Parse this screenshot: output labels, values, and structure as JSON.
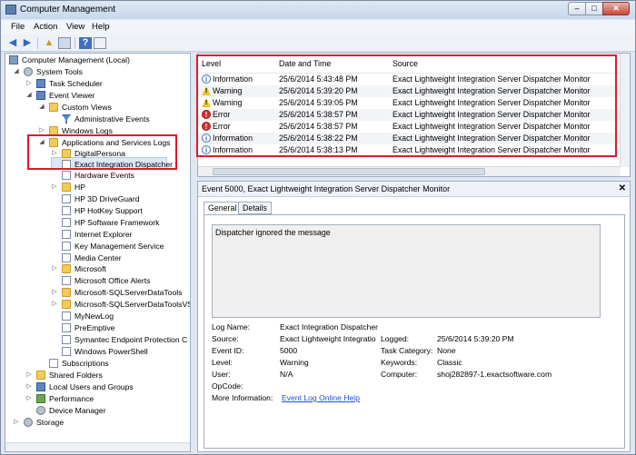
{
  "window": {
    "title": "Computer Management"
  },
  "menu": {
    "items": [
      "File",
      "Action",
      "View",
      "Help"
    ]
  },
  "tree": {
    "nodes": [
      "Computer Management (Local)",
      "System Tools",
      "Task Scheduler",
      "Event Viewer",
      "Custom Views",
      "Administrative Events",
      "Windows Logs",
      "Applications and Services Logs",
      "DigitalPersona",
      "Exact Integration Dispatcher",
      "Hardware Events",
      "HP",
      "HP 3D DriveGuard",
      "HP HotKey Support",
      "HP Software Framework",
      "Internet Explorer",
      "Key Management Service",
      "Media Center",
      "Microsoft",
      "Microsoft Office Alerts",
      "Microsoft-SQLServerDataTools",
      "Microsoft-SQLServerDataToolsVS",
      "MyNewLog",
      "PreEmptive",
      "Symantec Endpoint Protection C",
      "Windows PowerShell",
      "Subscriptions",
      "Shared Folders",
      "Local Users and Groups",
      "Performance",
      "Device Manager",
      "Storage"
    ]
  },
  "events": {
    "columns": [
      "Level",
      "Date and Time",
      "Source"
    ],
    "rows": [
      {
        "level": "Information",
        "icon": "info-icon",
        "datetime": "25/6/2014 5:43:48 PM",
        "source": "Exact Lightweight Integration Server Dispatcher Monitor"
      },
      {
        "level": "Warning",
        "icon": "warning-icon",
        "datetime": "25/6/2014 5:39:20 PM",
        "source": "Exact Lightweight Integration Server Dispatcher Monitor"
      },
      {
        "level": "Warning",
        "icon": "warning-icon",
        "datetime": "25/6/2014 5:39:05 PM",
        "source": "Exact Lightweight Integration Server Dispatcher Monitor"
      },
      {
        "level": "Error",
        "icon": "error-icon",
        "datetime": "25/6/2014 5:38:57 PM",
        "source": "Exact Lightweight Integration Server Dispatcher Monitor"
      },
      {
        "level": "Error",
        "icon": "error-icon",
        "datetime": "25/6/2014 5:38:57 PM",
        "source": "Exact Lightweight Integration Server Dispatcher Monitor"
      },
      {
        "level": "Information",
        "icon": "info-icon",
        "datetime": "25/6/2014 5:38:22 PM",
        "source": "Exact Lightweight Integration Server Dispatcher Monitor"
      },
      {
        "level": "Information",
        "icon": "info-icon",
        "datetime": "25/6/2014 5:38:13 PM",
        "source": "Exact Lightweight Integration Server Dispatcher Monitor"
      }
    ]
  },
  "detail": {
    "title": "Event 5000, Exact Lightweight Integration Server Dispatcher Monitor",
    "tabs": [
      "General",
      "Details"
    ],
    "message": "Dispatcher ignored the message",
    "labels": {
      "log_name": "Log Name:",
      "source": "Source:",
      "event_id": "Event ID:",
      "level": "Level:",
      "user": "User:",
      "opcode": "OpCode:",
      "more_info": "More Information:",
      "logged": "Logged:",
      "task_category": "Task Category:",
      "keywords": "Keywords:",
      "computer": "Computer:"
    },
    "values": {
      "log_name": "Exact Integration Dispatcher",
      "source": "Exact Lightweight Integratio",
      "event_id": "5000",
      "level": "Warning",
      "user": "N/A",
      "opcode": "",
      "more_info_link": "Event Log Online Help",
      "logged": "25/6/2014 5:39:20 PM",
      "task_category": "None",
      "keywords": "Classic",
      "computer": "shoj282897-1.exactsoftware.com"
    }
  },
  "colors": {
    "highlight_box": "#e0192a",
    "link": "#1f4fd1"
  }
}
